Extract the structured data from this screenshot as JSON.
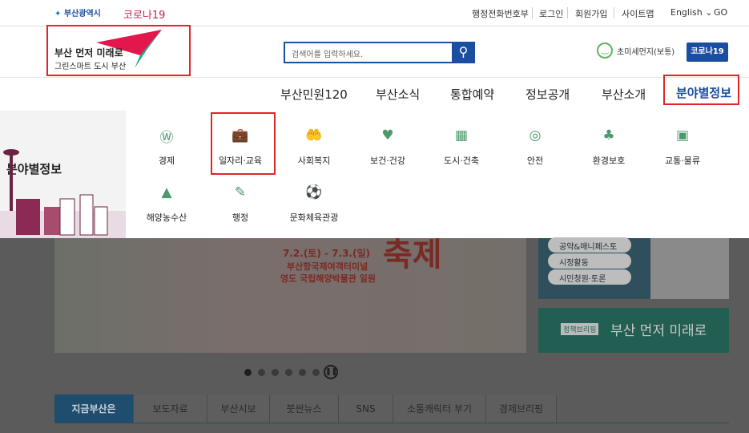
{
  "topbar": {
    "brand": "부산광역시",
    "corona": "코로나19",
    "links": [
      "행정전화번호부",
      "로그인",
      "회원가입",
      "사이트맵"
    ],
    "lang": "English",
    "go": "GO"
  },
  "header": {
    "logo_line1": "부산 먼저 미래로",
    "logo_line2": "그린스마트 도시 부산",
    "search_placeholder": "검색어를 입력하세요.",
    "dust": "초미세먼지(보통)",
    "corona_btn": "코로나19"
  },
  "nav": {
    "items": [
      "부산민원120",
      "부산소식",
      "통합예약",
      "정보공개",
      "부산소개",
      "분야별정보"
    ],
    "active_color": "#1a4ea1"
  },
  "mega": {
    "title": "분야별정보",
    "items": [
      {
        "label": "경제",
        "icon": "money-icon"
      },
      {
        "label": "일자리·교육",
        "icon": "briefcase-icon"
      },
      {
        "label": "사회복지",
        "icon": "hands-icon"
      },
      {
        "label": "보건·건강",
        "icon": "heart-icon"
      },
      {
        "label": "도시·건축",
        "icon": "building-icon"
      },
      {
        "label": "안전",
        "icon": "lifebuoy-icon"
      },
      {
        "label": "환경보호",
        "icon": "trees-icon"
      },
      {
        "label": "교통·물류",
        "icon": "bus-icon"
      },
      {
        "label": "해양농수산",
        "icon": "lighthouse-icon"
      },
      {
        "label": "행정",
        "icon": "document-icon"
      },
      {
        "label": "문화체육관광",
        "icon": "ball-icon"
      }
    ]
  },
  "banner": {
    "date": "7.2.(토) - 7.3.(일)",
    "place1": "부산항국제여객터미널",
    "place2": "영도 국립해양박물관 일원",
    "title_fragment": "축제"
  },
  "side": {
    "pills": [
      "공약&매니페스토",
      "시정활동",
      "시민청원·토론"
    ],
    "briefing_tag": "정책브리핑",
    "briefing_text": "부산 먼저 미래로"
  },
  "tabs": [
    "지금부산은",
    "보도자료",
    "부산시보",
    "붓싼뉴스",
    "SNS",
    "소통캐릭터 부기",
    "경제브리핑"
  ],
  "colors": {
    "accent": "#1a4ea1",
    "highlight": "#e0242a",
    "dim": "#5b5b5b"
  }
}
